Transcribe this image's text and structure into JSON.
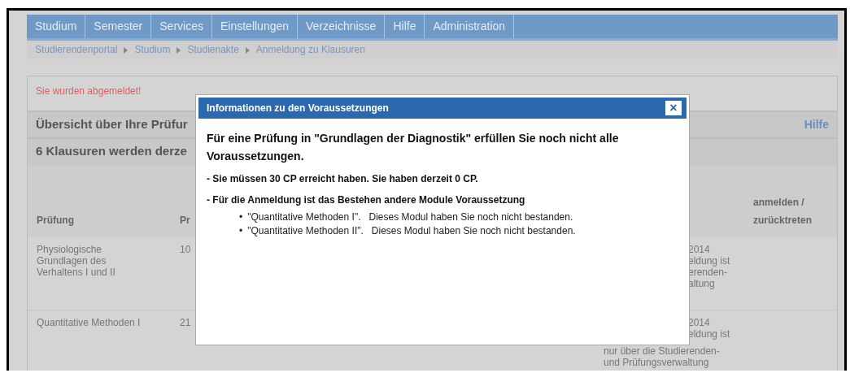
{
  "nav": {
    "items": [
      "Studium",
      "Semester",
      "Services",
      "Einstellungen",
      "Verzeichnisse",
      "Hilfe",
      "Administration"
    ]
  },
  "breadcrumb": [
    "Studierendenportal",
    "Studium",
    "Studienakte",
    "Anmeldung zu Klausuren"
  ],
  "message": "Sie wurden abgemeldet!",
  "overview": {
    "title": "Übersicht über Ihre Prüfur",
    "help_link": "Hilfe"
  },
  "count_title": "6 Klausuren werden derze",
  "table": {
    "columns": [
      {
        "label": "Prüfung"
      },
      {
        "label": "Pr"
      },
      {},
      {
        "label": "anmelden / zurücktreten"
      }
    ],
    "rows": [
      {
        "cells": [
          "Physiologische Grundlagen des Verhaltens I und II",
          "10"
        ],
        "note_beside_dialog": [
          "2014",
          "eldung ist",
          "erenden-",
          "altung"
        ]
      },
      {
        "cells": [
          "Quantitative Methoden I",
          "21"
        ],
        "note_beside_dialog": [
          "2014",
          "eldung ist"
        ],
        "note_below_dialog": [
          "nur über die Studierenden-",
          "und Prüfungsverwaltung"
        ]
      }
    ]
  },
  "dialog": {
    "title": "Informationen zu den Voraussetzungen",
    "close": "×",
    "heading": "Für eine Prüfung in \"Grundlagen der Diagnostik\" erfüllen Sie noch nicht alle Voraussetzungen.",
    "requirements": [
      {
        "text": "- Sie müssen 30 CP erreicht haben. Sie haben derzeit 0 CP."
      },
      {
        "text": "- Für die Anmeldung ist das Bestehen andere Module Voraussetzung",
        "items": [
          {
            "bullet": "•",
            "text": "\"Quantitative Methoden I\".   Dieses Modul haben Sie noch nicht bestanden."
          },
          {
            "bullet": "•",
            "text": "\"Quantitative Methoden II\".   Dieses Modul haben Sie noch nicht bestanden."
          }
        ]
      }
    ]
  }
}
